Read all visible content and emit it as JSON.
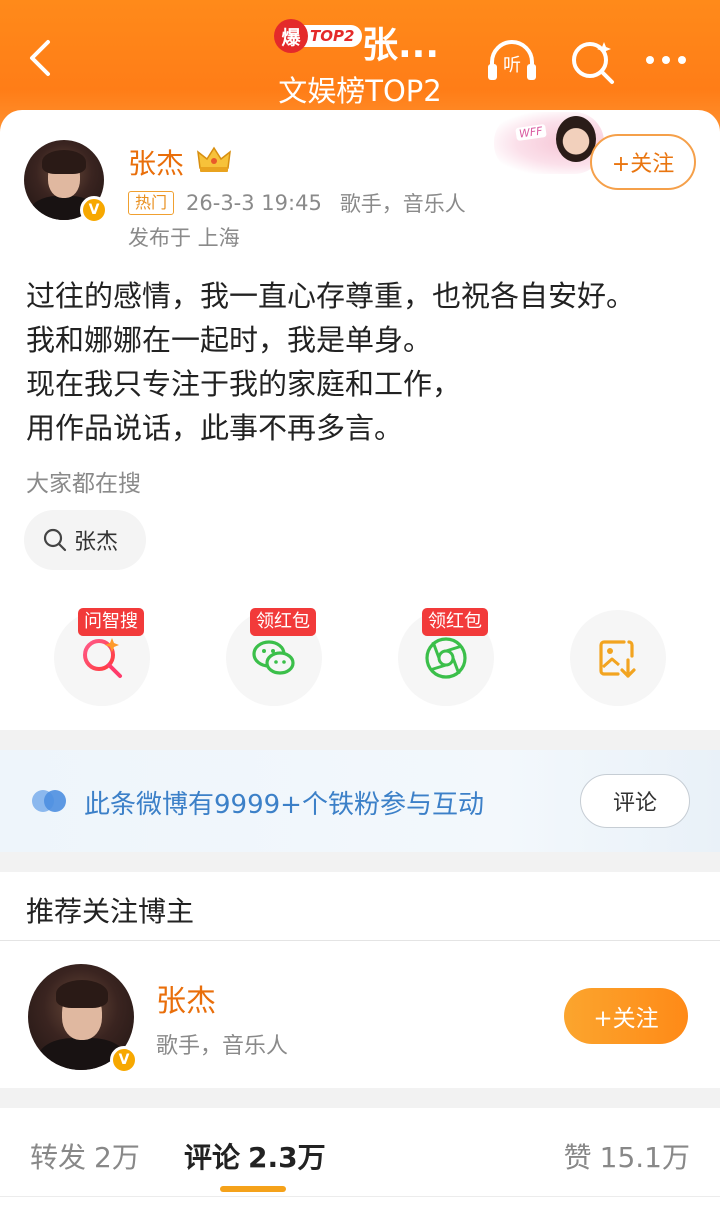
{
  "header": {
    "hot_char": "爆",
    "hot_rank": "TOP2",
    "topic": "张...",
    "board_rank": "文娱榜TOP2",
    "icons": [
      "back-icon",
      "listen-icon",
      "search-spark-icon",
      "more-icon"
    ],
    "listen_glyph": "听"
  },
  "post": {
    "user_name": "张杰",
    "v_mark": "V",
    "hot_tag": "热门",
    "time": "26-3-3 19:45",
    "identity": "歌手，音乐人",
    "location": "发布于 上海",
    "follow_label": "+关注",
    "banner_tag": "WFF",
    "text_lines": [
      "过往的感情，我一直心存尊重，也祝各自安好。",
      "我和娜娜在一起时，我是单身。",
      "现在我只专注于我的家庭和工作，",
      "用作品说话，此事不再多言。"
    ],
    "search_label": "大家都在搜",
    "search_chip": "张杰",
    "actions": [
      {
        "badge": "问智搜",
        "icon": "ai-search-icon"
      },
      {
        "badge": "领红包",
        "icon": "wechat-icon"
      },
      {
        "badge": "领红包",
        "icon": "moments-icon"
      },
      {
        "badge": "",
        "icon": "save-image-icon"
      }
    ]
  },
  "fans": {
    "text": "此条微博有9999+个铁粉参与互动",
    "comment_label": "评论"
  },
  "recommend": {
    "title": "推荐关注博主",
    "name": "张杰",
    "desc": "歌手，音乐人",
    "follow_label": "+关注"
  },
  "tabs": {
    "forward_label": "转发",
    "forward_count": "2万",
    "comment_label": "评论",
    "comment_count": "2.3万",
    "like_label": "赞",
    "like_count": "15.1万"
  },
  "colors": {
    "header": "#ff7d17",
    "accent": "#e96e0a",
    "link_blue": "#3c80c8",
    "badge_red": "#f23a3a"
  }
}
